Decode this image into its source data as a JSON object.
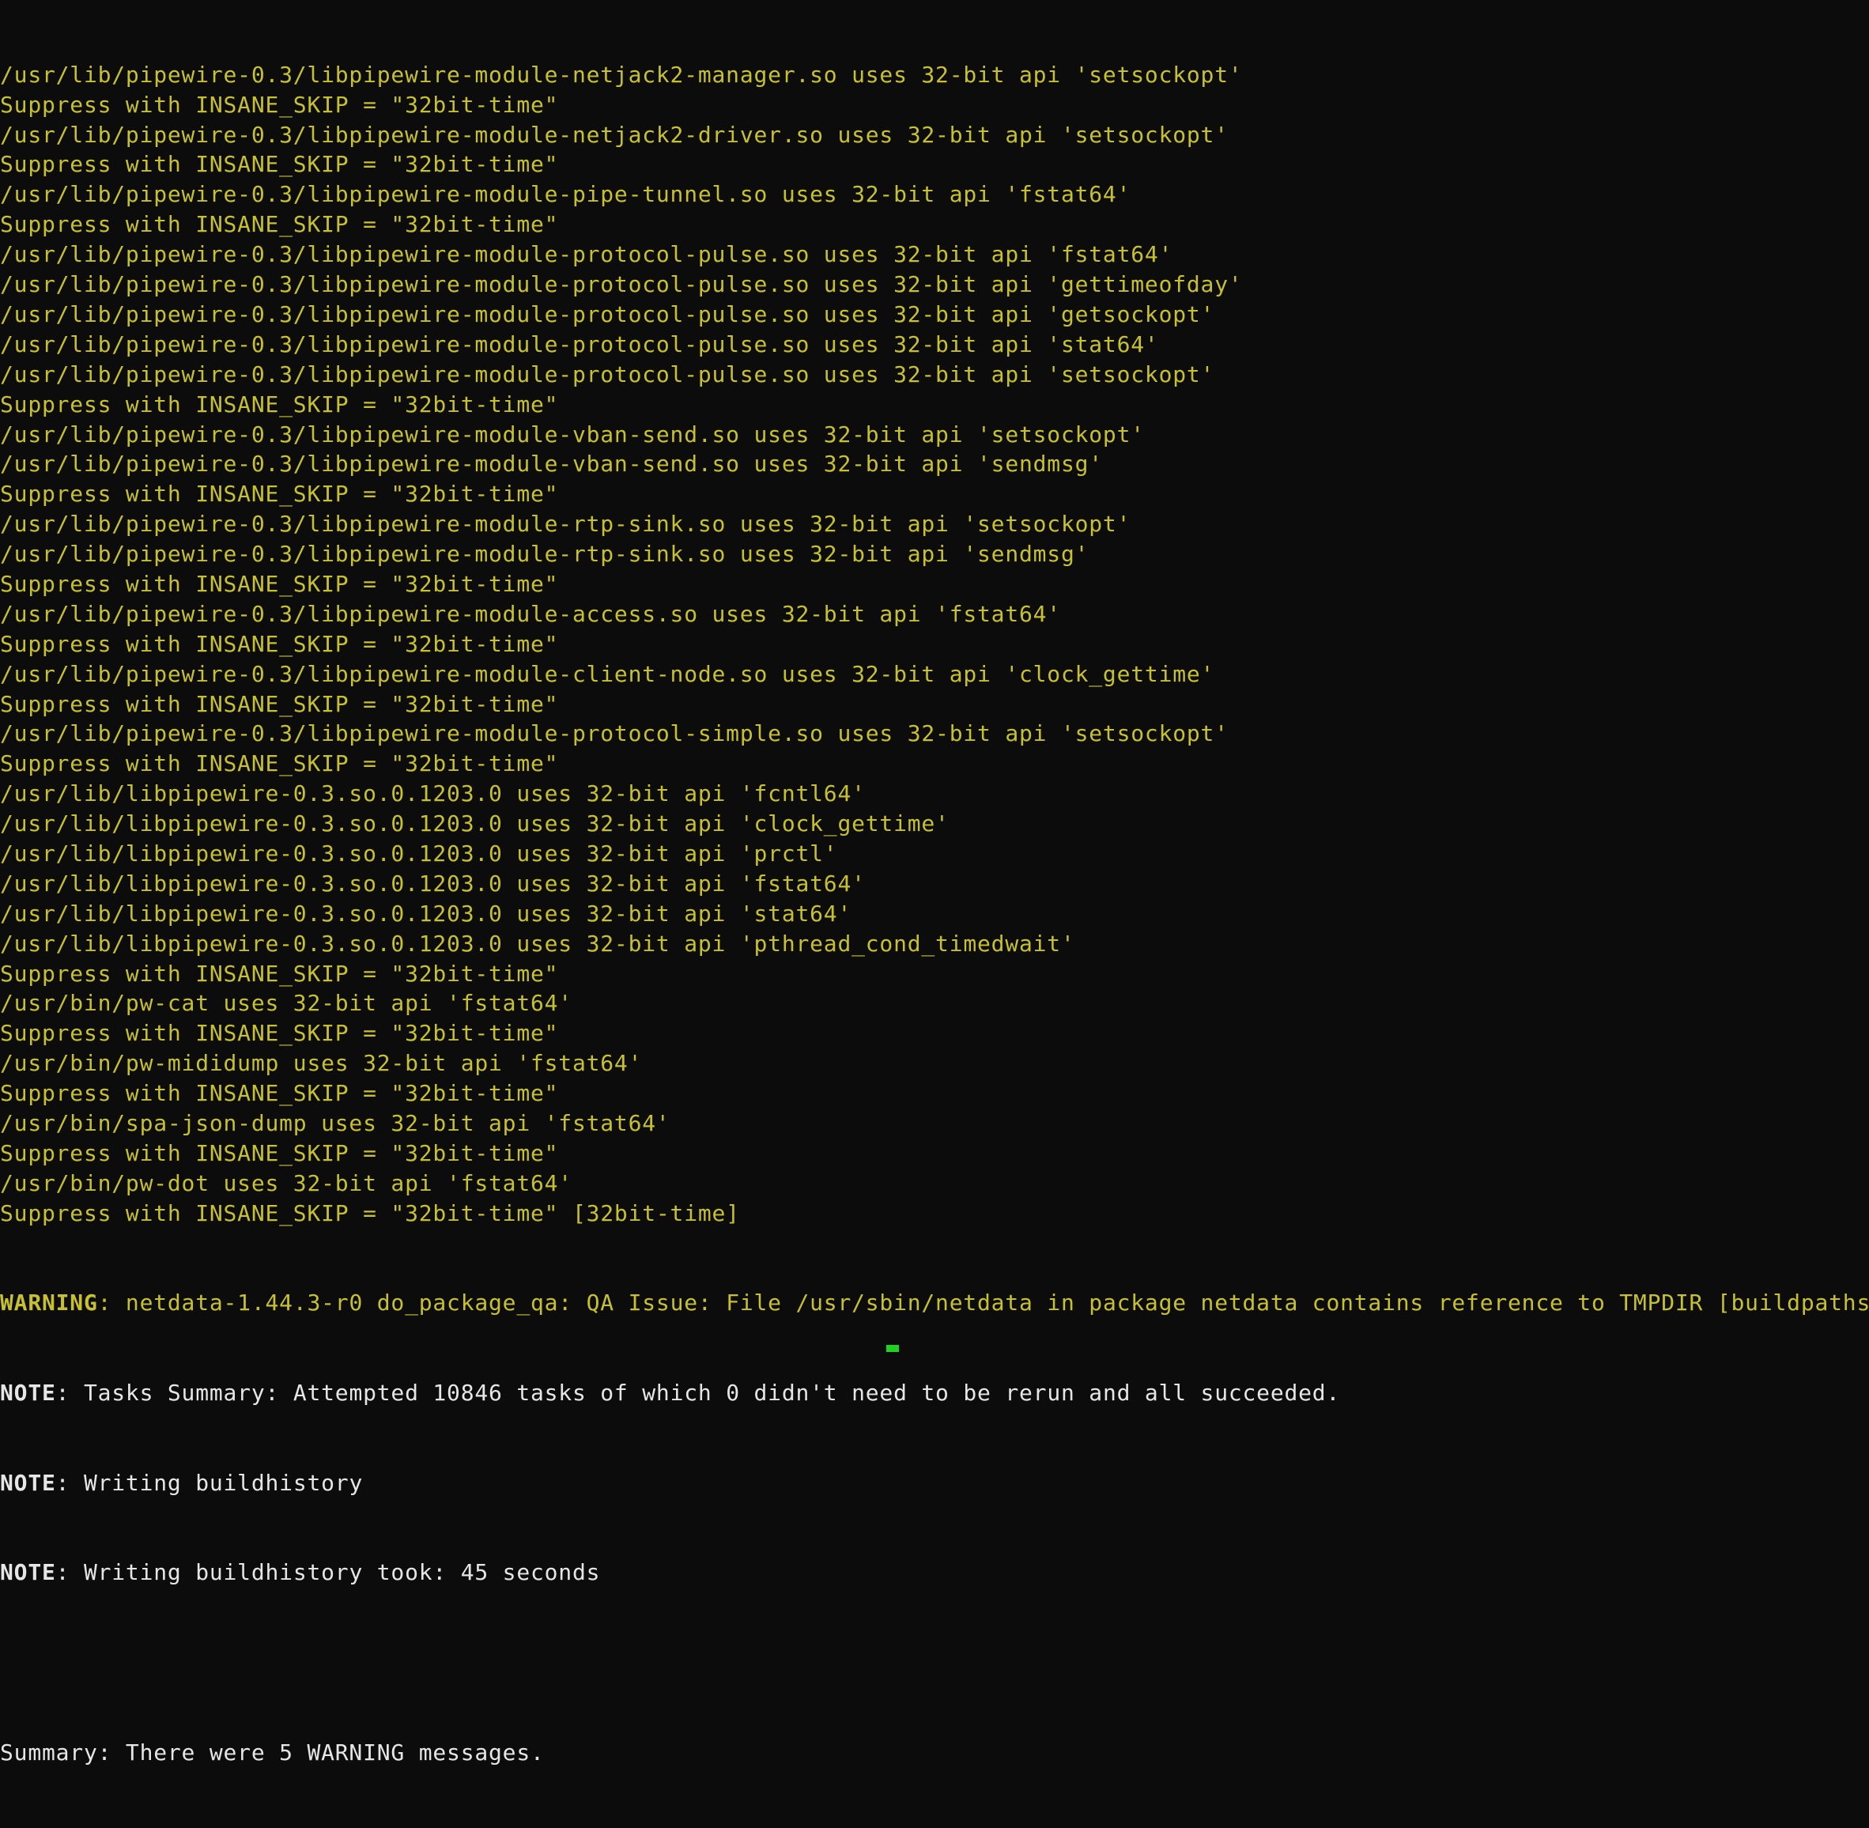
{
  "terminal": {
    "qa_lines": [
      "/usr/lib/pipewire-0.3/libpipewire-module-netjack2-manager.so uses 32-bit api 'setsockopt'",
      "Suppress with INSANE_SKIP = \"32bit-time\"",
      "/usr/lib/pipewire-0.3/libpipewire-module-netjack2-driver.so uses 32-bit api 'setsockopt'",
      "Suppress with INSANE_SKIP = \"32bit-time\"",
      "/usr/lib/pipewire-0.3/libpipewire-module-pipe-tunnel.so uses 32-bit api 'fstat64'",
      "Suppress with INSANE_SKIP = \"32bit-time\"",
      "/usr/lib/pipewire-0.3/libpipewire-module-protocol-pulse.so uses 32-bit api 'fstat64'",
      "/usr/lib/pipewire-0.3/libpipewire-module-protocol-pulse.so uses 32-bit api 'gettimeofday'",
      "/usr/lib/pipewire-0.3/libpipewire-module-protocol-pulse.so uses 32-bit api 'getsockopt'",
      "/usr/lib/pipewire-0.3/libpipewire-module-protocol-pulse.so uses 32-bit api 'stat64'",
      "/usr/lib/pipewire-0.3/libpipewire-module-protocol-pulse.so uses 32-bit api 'setsockopt'",
      "Suppress with INSANE_SKIP = \"32bit-time\"",
      "/usr/lib/pipewire-0.3/libpipewire-module-vban-send.so uses 32-bit api 'setsockopt'",
      "/usr/lib/pipewire-0.3/libpipewire-module-vban-send.so uses 32-bit api 'sendmsg'",
      "Suppress with INSANE_SKIP = \"32bit-time\"",
      "/usr/lib/pipewire-0.3/libpipewire-module-rtp-sink.so uses 32-bit api 'setsockopt'",
      "/usr/lib/pipewire-0.3/libpipewire-module-rtp-sink.so uses 32-bit api 'sendmsg'",
      "Suppress with INSANE_SKIP = \"32bit-time\"",
      "/usr/lib/pipewire-0.3/libpipewire-module-access.so uses 32-bit api 'fstat64'",
      "Suppress with INSANE_SKIP = \"32bit-time\"",
      "/usr/lib/pipewire-0.3/libpipewire-module-client-node.so uses 32-bit api 'clock_gettime'",
      "Suppress with INSANE_SKIP = \"32bit-time\"",
      "/usr/lib/pipewire-0.3/libpipewire-module-protocol-simple.so uses 32-bit api 'setsockopt'",
      "Suppress with INSANE_SKIP = \"32bit-time\"",
      "/usr/lib/libpipewire-0.3.so.0.1203.0 uses 32-bit api 'fcntl64'",
      "/usr/lib/libpipewire-0.3.so.0.1203.0 uses 32-bit api 'clock_gettime'",
      "/usr/lib/libpipewire-0.3.so.0.1203.0 uses 32-bit api 'prctl'",
      "/usr/lib/libpipewire-0.3.so.0.1203.0 uses 32-bit api 'fstat64'",
      "/usr/lib/libpipewire-0.3.so.0.1203.0 uses 32-bit api 'stat64'",
      "/usr/lib/libpipewire-0.3.so.0.1203.0 uses 32-bit api 'pthread_cond_timedwait'",
      "Suppress with INSANE_SKIP = \"32bit-time\"",
      "/usr/bin/pw-cat uses 32-bit api 'fstat64'",
      "Suppress with INSANE_SKIP = \"32bit-time\"",
      "/usr/bin/pw-mididump uses 32-bit api 'fstat64'",
      "Suppress with INSANE_SKIP = \"32bit-time\"",
      "/usr/bin/spa-json-dump uses 32-bit api 'fstat64'",
      "Suppress with INSANE_SKIP = \"32bit-time\"",
      "/usr/bin/pw-dot uses 32-bit api 'fstat64'",
      "Suppress with INSANE_SKIP = \"32bit-time\" [32bit-time]"
    ],
    "warning": {
      "prefix": "WARNING",
      "text": ": netdata-1.44.3-r0 do_package_qa: QA Issue: File /usr/sbin/netdata in package netdata contains reference to TMPDIR [buildpaths]"
    },
    "notes": [
      {
        "prefix": "NOTE",
        "text": ": Tasks Summary: Attempted 10846 tasks of which 0 didn't need to be rerun and all succeeded."
      },
      {
        "prefix": "NOTE",
        "text": ": Writing buildhistory"
      },
      {
        "prefix": "NOTE",
        "text": ": Writing buildhistory took: 45 seconds"
      }
    ],
    "blank_line": "",
    "summary": "Summary: There were 5 WARNING messages.",
    "colors": {
      "background": "#0c0c0c",
      "qa_text": "#c7c12f",
      "normal_text": "#e6e6e6",
      "cursor": "#21d121"
    }
  }
}
